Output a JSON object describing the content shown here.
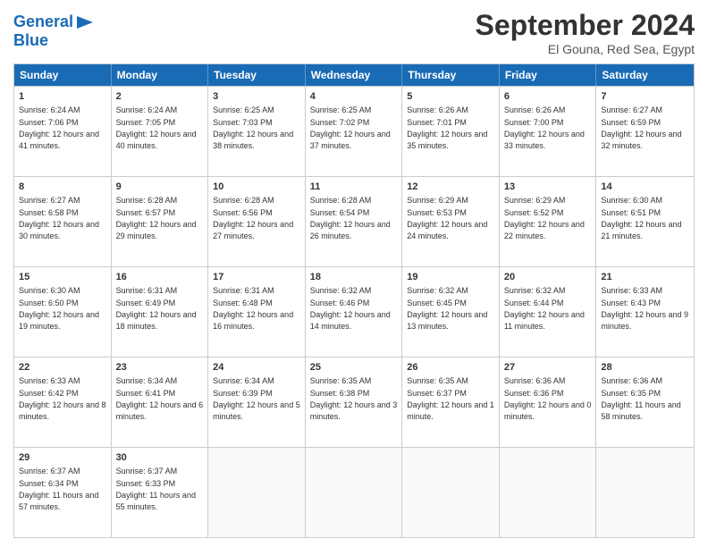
{
  "logo": {
    "line1": "General",
    "line2": "Blue",
    "icon": "▶"
  },
  "title": "September 2024",
  "subtitle": "El Gouna, Red Sea, Egypt",
  "header_days": [
    "Sunday",
    "Monday",
    "Tuesday",
    "Wednesday",
    "Thursday",
    "Friday",
    "Saturday"
  ],
  "weeks": [
    [
      {
        "day": "1",
        "sunrise": "Sunrise: 6:24 AM",
        "sunset": "Sunset: 7:06 PM",
        "daylight": "Daylight: 12 hours and 41 minutes."
      },
      {
        "day": "2",
        "sunrise": "Sunrise: 6:24 AM",
        "sunset": "Sunset: 7:05 PM",
        "daylight": "Daylight: 12 hours and 40 minutes."
      },
      {
        "day": "3",
        "sunrise": "Sunrise: 6:25 AM",
        "sunset": "Sunset: 7:03 PM",
        "daylight": "Daylight: 12 hours and 38 minutes."
      },
      {
        "day": "4",
        "sunrise": "Sunrise: 6:25 AM",
        "sunset": "Sunset: 7:02 PM",
        "daylight": "Daylight: 12 hours and 37 minutes."
      },
      {
        "day": "5",
        "sunrise": "Sunrise: 6:26 AM",
        "sunset": "Sunset: 7:01 PM",
        "daylight": "Daylight: 12 hours and 35 minutes."
      },
      {
        "day": "6",
        "sunrise": "Sunrise: 6:26 AM",
        "sunset": "Sunset: 7:00 PM",
        "daylight": "Daylight: 12 hours and 33 minutes."
      },
      {
        "day": "7",
        "sunrise": "Sunrise: 6:27 AM",
        "sunset": "Sunset: 6:59 PM",
        "daylight": "Daylight: 12 hours and 32 minutes."
      }
    ],
    [
      {
        "day": "8",
        "sunrise": "Sunrise: 6:27 AM",
        "sunset": "Sunset: 6:58 PM",
        "daylight": "Daylight: 12 hours and 30 minutes."
      },
      {
        "day": "9",
        "sunrise": "Sunrise: 6:28 AM",
        "sunset": "Sunset: 6:57 PM",
        "daylight": "Daylight: 12 hours and 29 minutes."
      },
      {
        "day": "10",
        "sunrise": "Sunrise: 6:28 AM",
        "sunset": "Sunset: 6:56 PM",
        "daylight": "Daylight: 12 hours and 27 minutes."
      },
      {
        "day": "11",
        "sunrise": "Sunrise: 6:28 AM",
        "sunset": "Sunset: 6:54 PM",
        "daylight": "Daylight: 12 hours and 26 minutes."
      },
      {
        "day": "12",
        "sunrise": "Sunrise: 6:29 AM",
        "sunset": "Sunset: 6:53 PM",
        "daylight": "Daylight: 12 hours and 24 minutes."
      },
      {
        "day": "13",
        "sunrise": "Sunrise: 6:29 AM",
        "sunset": "Sunset: 6:52 PM",
        "daylight": "Daylight: 12 hours and 22 minutes."
      },
      {
        "day": "14",
        "sunrise": "Sunrise: 6:30 AM",
        "sunset": "Sunset: 6:51 PM",
        "daylight": "Daylight: 12 hours and 21 minutes."
      }
    ],
    [
      {
        "day": "15",
        "sunrise": "Sunrise: 6:30 AM",
        "sunset": "Sunset: 6:50 PM",
        "daylight": "Daylight: 12 hours and 19 minutes."
      },
      {
        "day": "16",
        "sunrise": "Sunrise: 6:31 AM",
        "sunset": "Sunset: 6:49 PM",
        "daylight": "Daylight: 12 hours and 18 minutes."
      },
      {
        "day": "17",
        "sunrise": "Sunrise: 6:31 AM",
        "sunset": "Sunset: 6:48 PM",
        "daylight": "Daylight: 12 hours and 16 minutes."
      },
      {
        "day": "18",
        "sunrise": "Sunrise: 6:32 AM",
        "sunset": "Sunset: 6:46 PM",
        "daylight": "Daylight: 12 hours and 14 minutes."
      },
      {
        "day": "19",
        "sunrise": "Sunrise: 6:32 AM",
        "sunset": "Sunset: 6:45 PM",
        "daylight": "Daylight: 12 hours and 13 minutes."
      },
      {
        "day": "20",
        "sunrise": "Sunrise: 6:32 AM",
        "sunset": "Sunset: 6:44 PM",
        "daylight": "Daylight: 12 hours and 11 minutes."
      },
      {
        "day": "21",
        "sunrise": "Sunrise: 6:33 AM",
        "sunset": "Sunset: 6:43 PM",
        "daylight": "Daylight: 12 hours and 9 minutes."
      }
    ],
    [
      {
        "day": "22",
        "sunrise": "Sunrise: 6:33 AM",
        "sunset": "Sunset: 6:42 PM",
        "daylight": "Daylight: 12 hours and 8 minutes."
      },
      {
        "day": "23",
        "sunrise": "Sunrise: 6:34 AM",
        "sunset": "Sunset: 6:41 PM",
        "daylight": "Daylight: 12 hours and 6 minutes."
      },
      {
        "day": "24",
        "sunrise": "Sunrise: 6:34 AM",
        "sunset": "Sunset: 6:39 PM",
        "daylight": "Daylight: 12 hours and 5 minutes."
      },
      {
        "day": "25",
        "sunrise": "Sunrise: 6:35 AM",
        "sunset": "Sunset: 6:38 PM",
        "daylight": "Daylight: 12 hours and 3 minutes."
      },
      {
        "day": "26",
        "sunrise": "Sunrise: 6:35 AM",
        "sunset": "Sunset: 6:37 PM",
        "daylight": "Daylight: 12 hours and 1 minute."
      },
      {
        "day": "27",
        "sunrise": "Sunrise: 6:36 AM",
        "sunset": "Sunset: 6:36 PM",
        "daylight": "Daylight: 12 hours and 0 minutes."
      },
      {
        "day": "28",
        "sunrise": "Sunrise: 6:36 AM",
        "sunset": "Sunset: 6:35 PM",
        "daylight": "Daylight: 11 hours and 58 minutes."
      }
    ],
    [
      {
        "day": "29",
        "sunrise": "Sunrise: 6:37 AM",
        "sunset": "Sunset: 6:34 PM",
        "daylight": "Daylight: 11 hours and 57 minutes."
      },
      {
        "day": "30",
        "sunrise": "Sunrise: 6:37 AM",
        "sunset": "Sunset: 6:33 PM",
        "daylight": "Daylight: 11 hours and 55 minutes."
      },
      {
        "day": "",
        "sunrise": "",
        "sunset": "",
        "daylight": ""
      },
      {
        "day": "",
        "sunrise": "",
        "sunset": "",
        "daylight": ""
      },
      {
        "day": "",
        "sunrise": "",
        "sunset": "",
        "daylight": ""
      },
      {
        "day": "",
        "sunrise": "",
        "sunset": "",
        "daylight": ""
      },
      {
        "day": "",
        "sunrise": "",
        "sunset": "",
        "daylight": ""
      }
    ]
  ]
}
